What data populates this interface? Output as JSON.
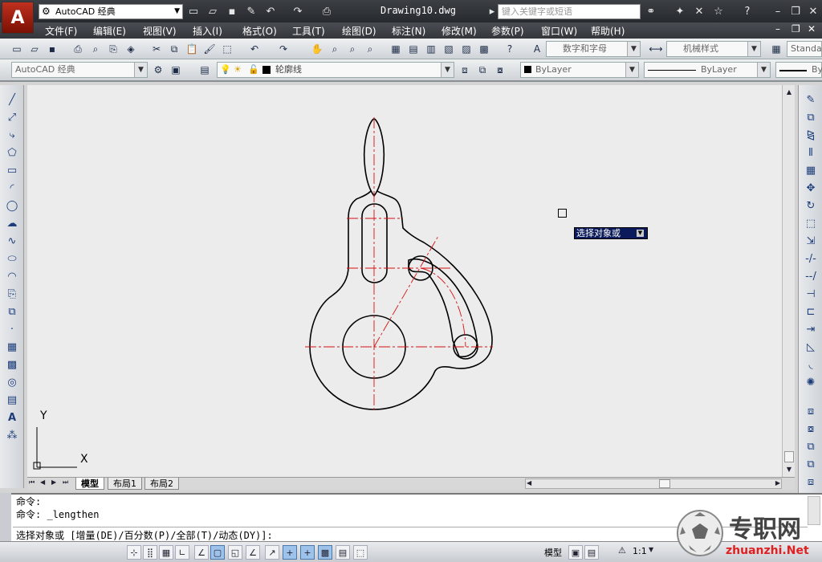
{
  "app": {
    "logo": "A",
    "workspace": "AutoCAD 经典",
    "document_title": "Drawing10.dwg",
    "search_placeholder": "键入关键字或短语"
  },
  "menus": [
    "文件(F)",
    "编辑(E)",
    "视图(V)",
    "插入(I)",
    "格式(O)",
    "工具(T)",
    "绘图(D)",
    "标注(N)",
    "修改(M)",
    "参数(P)",
    "窗口(W)",
    "帮助(H)"
  ],
  "toolbars": {
    "text_style": "数字和字母",
    "dim_style": "机械样式",
    "table_style": "Standa",
    "workspace": "AutoCAD 经典",
    "layer": "轮廓线",
    "color": "ByLayer",
    "linetype": "ByLayer",
    "lineweight": "By"
  },
  "drawing": {
    "tooltip": "选择对象或",
    "ucs_y": "Y",
    "ucs_x": "X",
    "colors": {
      "outline": "#000000",
      "center": "#d81010",
      "background": "#ececec"
    }
  },
  "tabs": [
    "模型",
    "布局1",
    "布局2"
  ],
  "command": {
    "history": [
      "命令:",
      "命令: _lengthen"
    ],
    "prompt": "选择对象或 [增量(DE)/百分数(P)/全部(T)/动态(DY)]:"
  },
  "status": {
    "model_label": "模型",
    "scale": "1:1"
  },
  "watermark": {
    "brand": "专职网",
    "url": "zhuanzhi.Net"
  }
}
